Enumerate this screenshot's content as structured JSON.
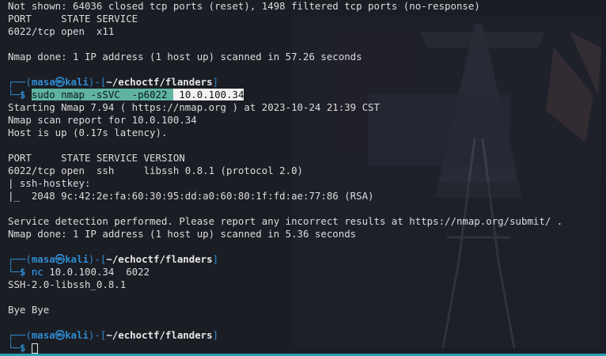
{
  "terminal": {
    "lines": [
      "Not shown: 64036 closed tcp ports (reset), 1498 filtered tcp ports (no-response)",
      "PORT     STATE SERVICE",
      "6022/tcp open  x11",
      "",
      "Nmap done: 1 IP address (1 host up) scanned in 57.26 seconds"
    ],
    "prompt1": {
      "corner_top": "┌──(",
      "user": "masa㉿kali",
      "sep": ")-[",
      "path": "~/echoctf/flanders",
      "end": "]",
      "corner_bottom": "└─",
      "dollar": "$ ",
      "cmd_sudo": "sudo",
      "cmd_nmap": "nmap",
      "cmd_args1": "-sSVC ",
      "cmd_args2": "-p6022 ",
      "cmd_ip": " 10.0.100.34"
    },
    "output2": [
      "Starting Nmap 7.94 ( https://nmap.org ) at 2023-10-24 21:39 CST",
      "Nmap scan report for 10.0.100.34",
      "Host is up (0.17s latency).",
      "",
      "PORT     STATE SERVICE VERSION",
      "6022/tcp open  ssh     libssh 0.8.1 (protocol 2.0)",
      "| ssh-hostkey:",
      "|_  2048 9c:42:2e:fa:60:30:95:dd:a0:60:80:1f:fd:ae:77:86 (RSA)",
      "",
      "Service detection performed. Please report any incorrect results at https://nmap.org/submit/ .",
      "Nmap done: 1 IP address (1 host up) scanned in 5.36 seconds"
    ],
    "prompt2": {
      "cmd": "nc",
      "args": " 10.0.100.34  6022"
    },
    "output3": [
      "SSH-2.0-libssh_0.8.1",
      "",
      "Bye Bye"
    ]
  },
  "colors": {
    "background": "#1b1d24",
    "prompt_blue": "#2f8bd0",
    "highlight_teal": "#5fb3a0",
    "accent_bar": "#2aa1b3"
  }
}
